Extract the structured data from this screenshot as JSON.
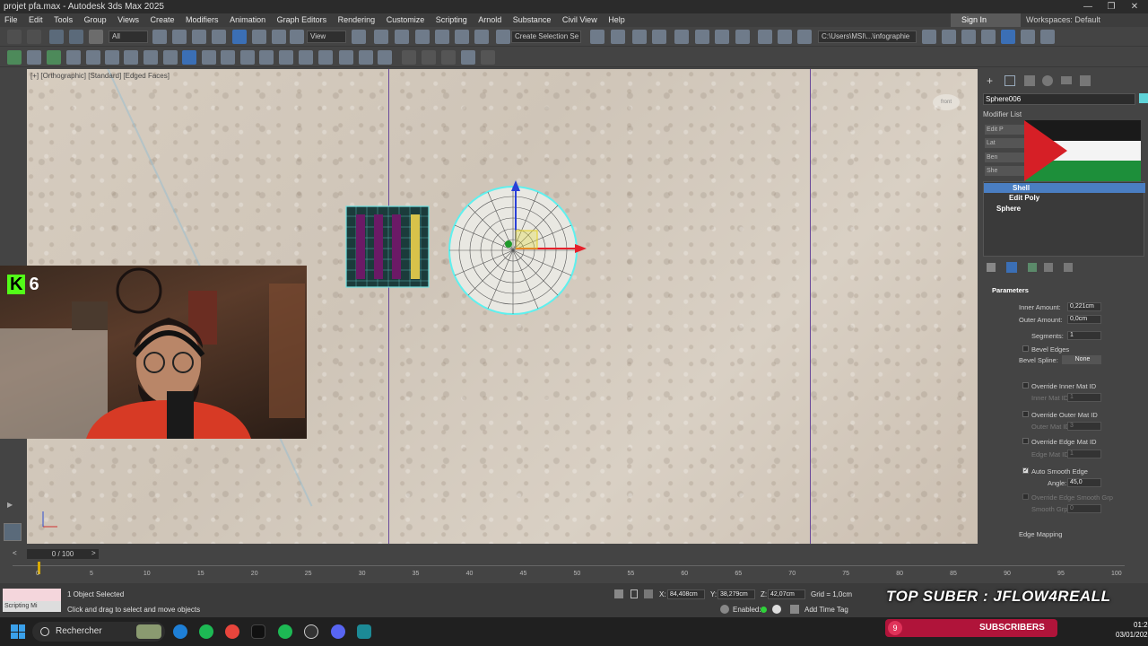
{
  "window": {
    "title": "projet pfa.max - Autodesk 3ds Max 2025",
    "controls": [
      "—",
      "❐",
      "✕"
    ]
  },
  "menu": {
    "items": [
      "File",
      "Edit",
      "Tools",
      "Group",
      "Views",
      "Create",
      "Modifiers",
      "Animation",
      "Graph Editors",
      "Rendering",
      "Customize",
      "Scripting",
      "Arnold",
      "Substance",
      "Civil View",
      "Help"
    ],
    "sign_in": "Sign In",
    "workspaces": "Workspaces: Default"
  },
  "toolbar": {
    "filter_value": "All",
    "view_value": "View",
    "selection_set_placeholder": "Create Selection Se",
    "path_value": "C:\\Users\\MSI\\...\\infographie"
  },
  "viewport": {
    "label": "[+] [Orthographic] [Standard] [Edged Faces]",
    "nav_cube": "front"
  },
  "webcam": {
    "platform_letter": "K",
    "viewer_count": "6"
  },
  "command_panel": {
    "object_name": "Sphere006",
    "object_color": "#5fd3d8",
    "modifier_list_label": "Modifier List",
    "quick_buttons": [
      "Edit P",
      "Lat",
      "Ben",
      "She"
    ],
    "stack": [
      {
        "label": "Shell",
        "selected": true
      },
      {
        "label": "Edit Poly",
        "selected": false
      },
      {
        "label": "Sphere",
        "selected": false
      }
    ],
    "params": {
      "header": "Parameters",
      "inner_amount_label": "Inner Amount:",
      "inner_amount": "0,221cm",
      "outer_amount_label": "Outer Amount:",
      "outer_amount": "0,0cm",
      "segments_label": "Segments:",
      "segments": "1",
      "bevel_edges": "Bevel Edges",
      "bevel_spline_label": "Bevel Spline:",
      "bevel_spline": "None",
      "override_inner": "Override Inner Mat ID",
      "inner_mat_label": "Inner Mat ID:",
      "inner_mat": "1",
      "override_outer": "Override Outer Mat ID",
      "outer_mat_label": "Outer Mat ID:",
      "outer_mat": "3",
      "override_edge": "Override Edge Mat ID",
      "edge_mat_label": "Edge Mat ID:",
      "edge_mat": "1",
      "auto_smooth": "Auto Smooth Edge",
      "angle_label": "Angle:",
      "angle": "45,0",
      "override_smooth": "Override Edge Smooth Grp",
      "smooth_grp_label": "Smooth Grp:",
      "smooth_grp": "0",
      "edge_mapping": "Edge Mapping"
    }
  },
  "timeline": {
    "slider": "0 / 100",
    "ticks": [
      "0",
      "5",
      "10",
      "15",
      "20",
      "25",
      "30",
      "35",
      "40",
      "45",
      "50",
      "55",
      "60",
      "65",
      "70",
      "75",
      "80",
      "85",
      "90",
      "95",
      "100"
    ]
  },
  "status": {
    "script_label": "Scripting Mi",
    "selected": "1 Object Selected",
    "hint": "Click and drag to select and move objects",
    "x_label": "X:",
    "x": "84,408cm",
    "y_label": "Y:",
    "y": "38,279cm",
    "z_label": "Z:",
    "z": "42,07cm",
    "grid": "Grid = 1,0cm",
    "enabled": "Enabled:",
    "add_time_tag": "Add Time Tag"
  },
  "overlay": {
    "top_suber": "TOP SUBER : JFLOW4REALL",
    "subscribers_count": "9",
    "subscribers_label": "SUBSCRIBERS"
  },
  "taskbar": {
    "search": "Rechercher",
    "time": "01:20",
    "date": "03/01/2026"
  }
}
